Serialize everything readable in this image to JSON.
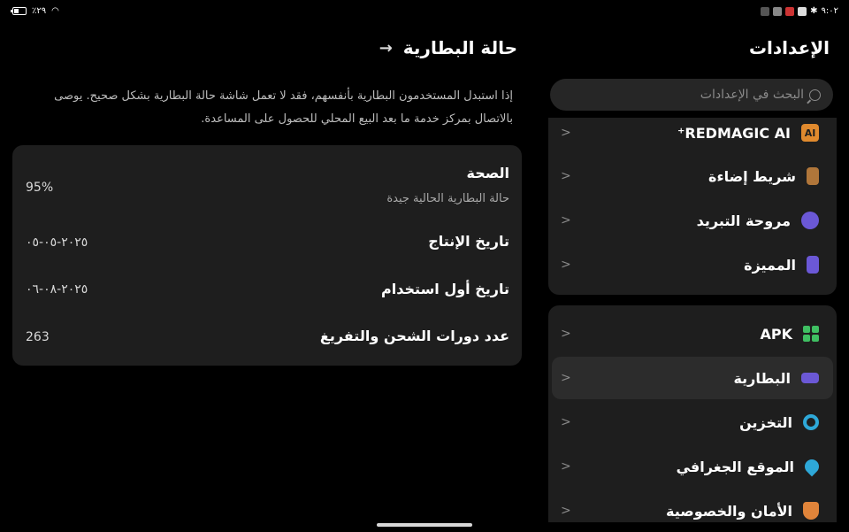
{
  "status_bar": {
    "battery_percent": "٪٢٩",
    "time": "٩:٠٢"
  },
  "settings": {
    "title": "الإعدادات",
    "search_placeholder": "البحث في الإعدادات",
    "group1": [
      {
        "label": "REDMAGIC AI⁺",
        "icon": "ai-icon",
        "color": "#e08a2e"
      },
      {
        "label": "شريط إضاءة",
        "icon": "light-strip-icon",
        "color": "#b0763a"
      },
      {
        "label": "مروحة التبريد",
        "icon": "fan-icon",
        "color": "#6b58d6"
      },
      {
        "label": "المميزة",
        "icon": "touch-icon",
        "color": "#6b58d6"
      }
    ],
    "group2": [
      {
        "label": "APK",
        "icon": "apk-icon",
        "color": "#3fbf62"
      },
      {
        "label": "البطارية",
        "icon": "battery-icon",
        "color": "#6b58d6"
      },
      {
        "label": "التخزين",
        "icon": "storage-icon",
        "color": "#2ea8d8"
      },
      {
        "label": "الموقع الجغرافي",
        "icon": "location-icon",
        "color": "#2ea8d8"
      },
      {
        "label": "الأمان والخصوصية",
        "icon": "shield-icon",
        "color": "#e0843a"
      }
    ]
  },
  "detail": {
    "title": "حالة البطارية",
    "note": "إذا استبدل المستخدمون البطارية بأنفسهم، فقد لا تعمل شاشة حالة البطارية بشكل صحيح. يوصى بالاتصال بمركز خدمة ما بعد البيع المحلي للحصول على المساعدة.",
    "items": {
      "health_label": "الصحة",
      "health_value": "95%",
      "health_sub": "حالة البطارية الحالية جيدة",
      "production_label": "تاريخ الإنتاج",
      "production_value": "٢٠٢٥-٠٥-٠٥",
      "first_use_label": "تاريخ أول استخدام",
      "first_use_value": "٢٠٢٥-٠٨-٠٦",
      "cycles_label": "عدد دورات الشحن والتفريغ",
      "cycles_value": "263"
    }
  }
}
